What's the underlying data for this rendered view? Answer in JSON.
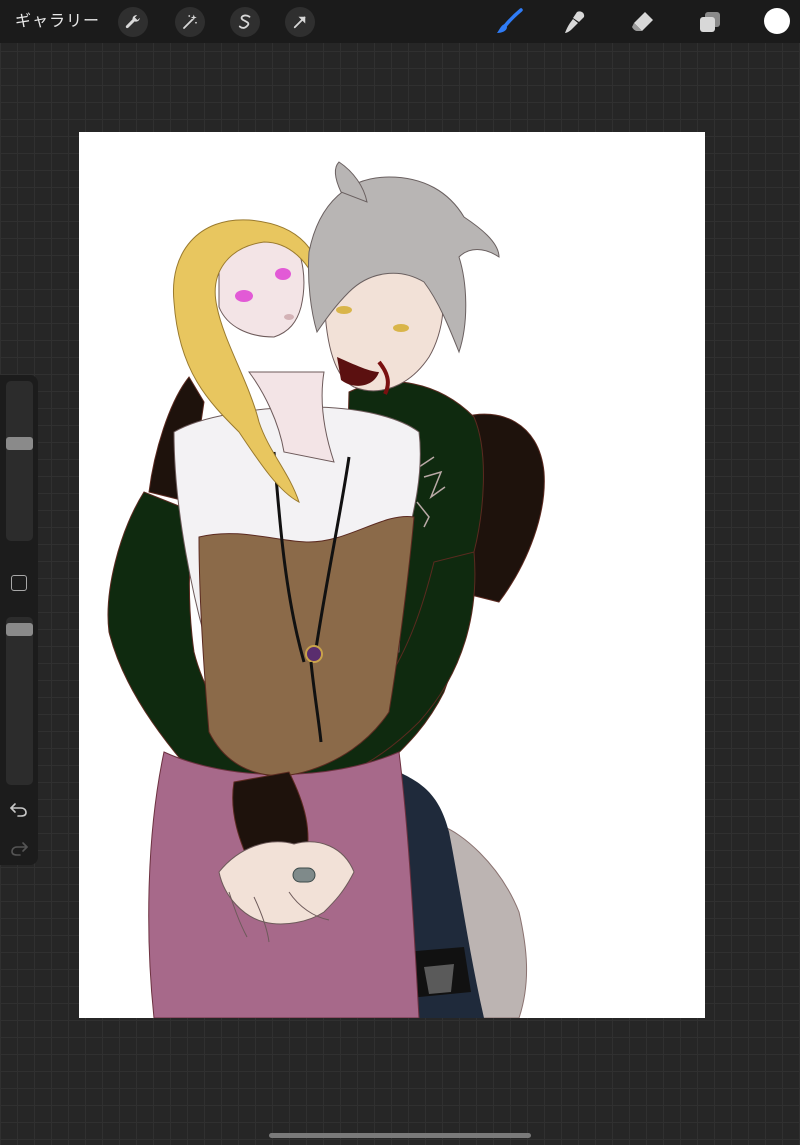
{
  "toolbar": {
    "gallery_label": "ギャラリー",
    "left_tools": [
      "wrench-icon",
      "magic-wand-icon",
      "selection-icon",
      "transform-arrow-icon"
    ],
    "right_tools": [
      "brush-icon",
      "smudge-icon",
      "eraser-icon",
      "layers-icon"
    ],
    "active_tool": "brush-icon",
    "accent_color": "#2f7cf6",
    "current_color": "#ffffff"
  },
  "sidebar": {
    "brush_size_level": 0.62,
    "opacity_level": 0.96,
    "icons": [
      "modify-square-icon",
      "undo-icon",
      "redo-icon"
    ]
  },
  "canvas": {
    "background": "#ffffff",
    "artwork_palette": {
      "jacket": "#0f2a0f",
      "corset": "#8b6a49",
      "skirt": "#a7698a",
      "shirt": "#f3f2f4",
      "blonde_hair": "#e8c65f",
      "grey_hair": "#b8b5b4",
      "skin": "#f3e4e6",
      "dark_sleeve": "#1e120c",
      "tail": "#bcb4b2"
    }
  }
}
